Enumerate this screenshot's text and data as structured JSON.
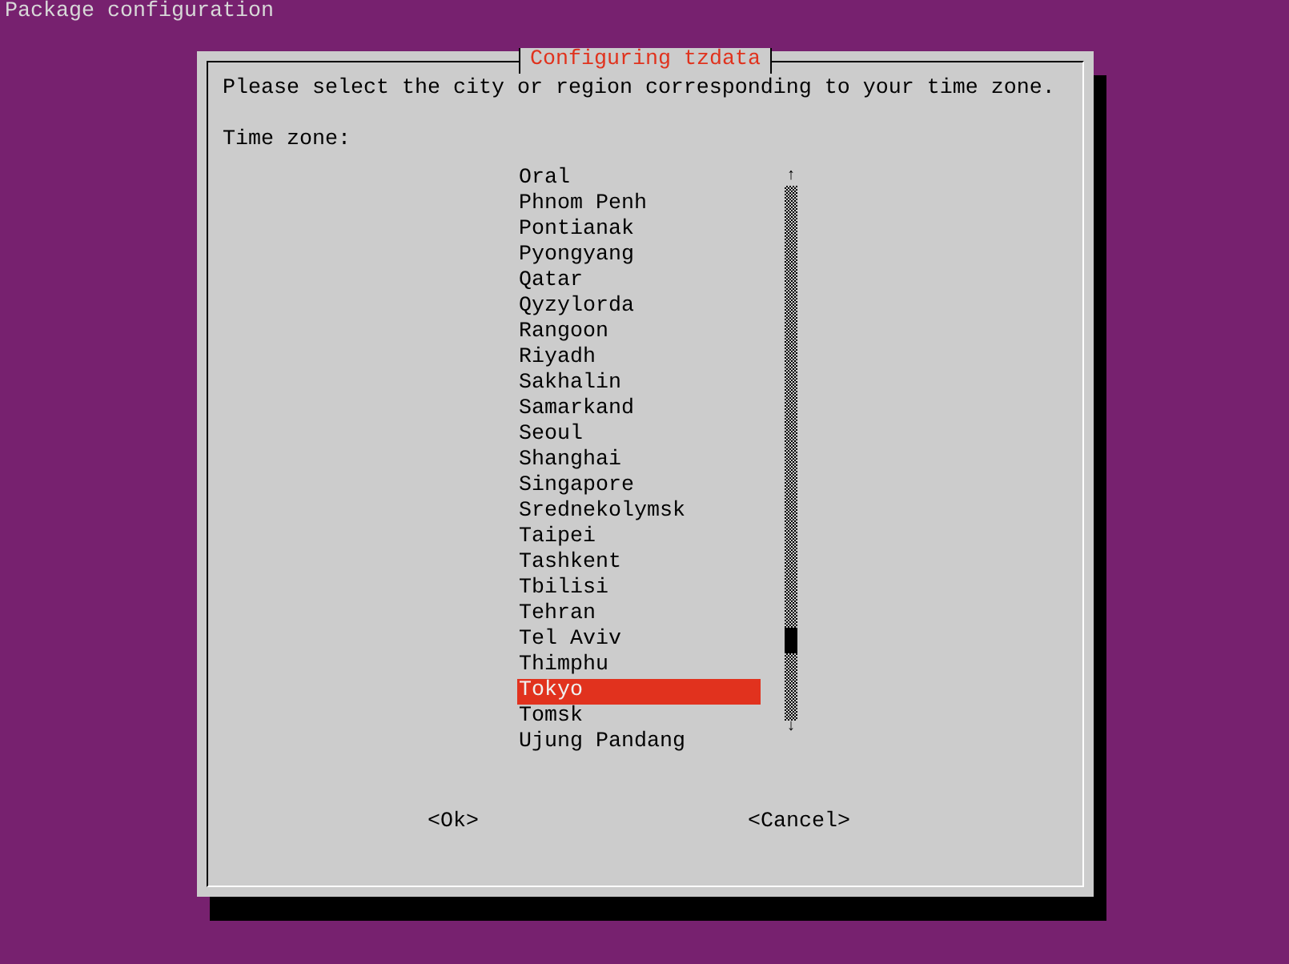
{
  "screen_title": "Package configuration",
  "dialog": {
    "title": "Configuring tzdata",
    "prompt": "Please select the city or region corresponding to your time zone.",
    "label": "Time zone:",
    "items": [
      {
        "label": "Oral",
        "selected": false
      },
      {
        "label": "Phnom Penh",
        "selected": false
      },
      {
        "label": "Pontianak",
        "selected": false
      },
      {
        "label": "Pyongyang",
        "selected": false
      },
      {
        "label": "Qatar",
        "selected": false
      },
      {
        "label": "Qyzylorda",
        "selected": false
      },
      {
        "label": "Rangoon",
        "selected": false
      },
      {
        "label": "Riyadh",
        "selected": false
      },
      {
        "label": "Sakhalin",
        "selected": false
      },
      {
        "label": "Samarkand",
        "selected": false
      },
      {
        "label": "Seoul",
        "selected": false
      },
      {
        "label": "Shanghai",
        "selected": false
      },
      {
        "label": "Singapore",
        "selected": false
      },
      {
        "label": "Srednekolymsk",
        "selected": false
      },
      {
        "label": "Taipei",
        "selected": false
      },
      {
        "label": "Tashkent",
        "selected": false
      },
      {
        "label": "Tbilisi",
        "selected": false
      },
      {
        "label": "Tehran",
        "selected": false
      },
      {
        "label": "Tel Aviv",
        "selected": false
      },
      {
        "label": "Thimphu",
        "selected": false
      },
      {
        "label": "Tokyo",
        "selected": true
      },
      {
        "label": "Tomsk",
        "selected": false
      },
      {
        "label": "Ujung Pandang",
        "selected": false
      }
    ],
    "scroll_up": "↑",
    "scroll_down": "↓",
    "buttons": [
      "<Ok>",
      "<Cancel>"
    ]
  }
}
